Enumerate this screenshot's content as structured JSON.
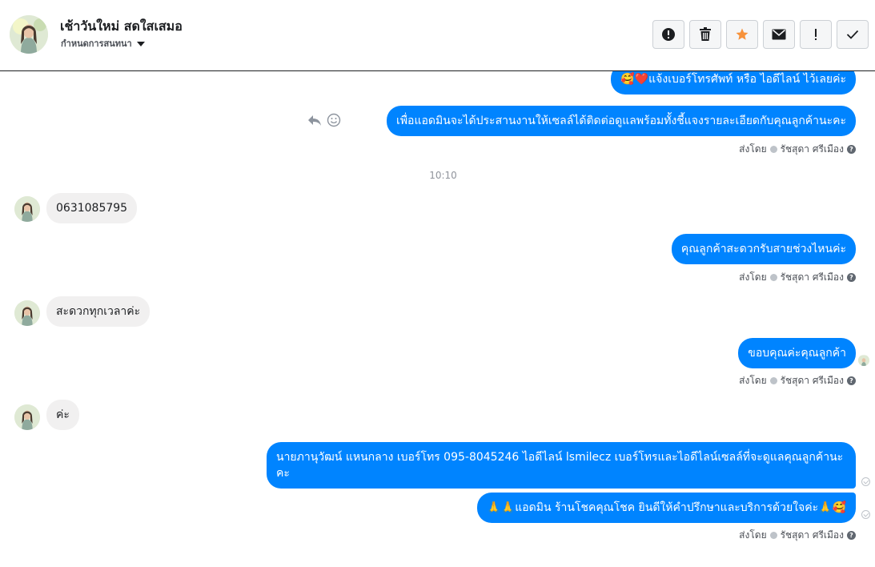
{
  "conversation": {
    "contact_name": "เช้าวันใหม่ สดใสเสมอ",
    "assign_label": "กำหนดการสนทนา"
  },
  "toolbar": {
    "buttons": [
      {
        "icon": "alert-circle-icon"
      },
      {
        "icon": "trash-icon"
      },
      {
        "icon": "star-icon",
        "color": "#f7923b"
      },
      {
        "icon": "envelope-icon"
      },
      {
        "icon": "exclamation-icon"
      },
      {
        "icon": "check-icon"
      }
    ]
  },
  "messages": {
    "m1": "🥰❤️แจ้งเบอร์โทรศัพท์ หรือ ไอดีไลน์  ไว้เลยค่ะ",
    "m2": "เพื่อแอดมินจะได้ประสานงานให้เซลล์ได้ติดต่อดูแลพร้อมทั้งชี้แจงรายละเอียดกับคุณลูกค้านะคะ",
    "time_divider": "10:10",
    "m3": "0631085795",
    "m4": "คุณลูกค้าสะดวกรับสายช่วงไหนค่ะ",
    "m5": "สะดวกทุกเวลาค่ะ",
    "m6": "ขอบคุณค่ะคุณลูกค้า",
    "m7": "ค่ะ",
    "m8": "นายภานุวัฒน์ แหนกลาง เบอร์โทร 095-8045246 ไอดีไลน์ lsmilecz   เบอร์โทรและไอดีไลน์เซลล์ที่จะดูแลคุณลูกค้านะคะ",
    "m9": "🙏🙏แอดมิน ร้านโชคคุณโชค ยินดีให้คำปรึกษาและบริการด้วยใจค่ะ🙏🥰"
  },
  "sent_by": {
    "prefix": "ส่งโดย",
    "agent": "รัชสุดา ศรีเมือง"
  },
  "colors": {
    "outgoing_bubble": "#0084ff",
    "incoming_bubble": "#f1f0f0"
  }
}
